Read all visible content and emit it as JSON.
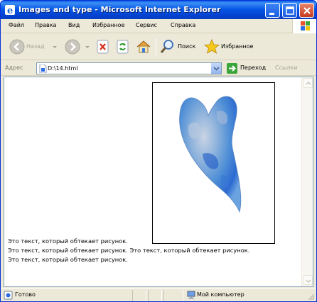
{
  "window": {
    "title": "Images and type - Microsoft Internet Explorer",
    "icon": "ie-icon"
  },
  "menu": {
    "items": [
      "Файл",
      "Правка",
      "Вид",
      "Избранное",
      "Сервис",
      "Справка"
    ]
  },
  "toolbar": {
    "back_label": "Назад",
    "search_label": "Поиск",
    "favorites_label": "Избранное"
  },
  "address": {
    "label": "Адрес",
    "value": "D:\\14.html",
    "go_label": "Переход",
    "links_label": "Ссылки"
  },
  "page": {
    "image_name": "heart-image",
    "lines": [
      "Это текст, который обтекает рисунок.",
      "Это текст, который обтекает рисунок. Это текст, который обтекает рисунок.",
      "Это текст, который обтекает рисунок."
    ]
  },
  "status": {
    "text": "Готово",
    "zone": "Мой компьютер"
  },
  "colors": {
    "titlebar": "#0758e8",
    "chrome": "#ece9d8",
    "accent_green": "#3aa53a"
  }
}
